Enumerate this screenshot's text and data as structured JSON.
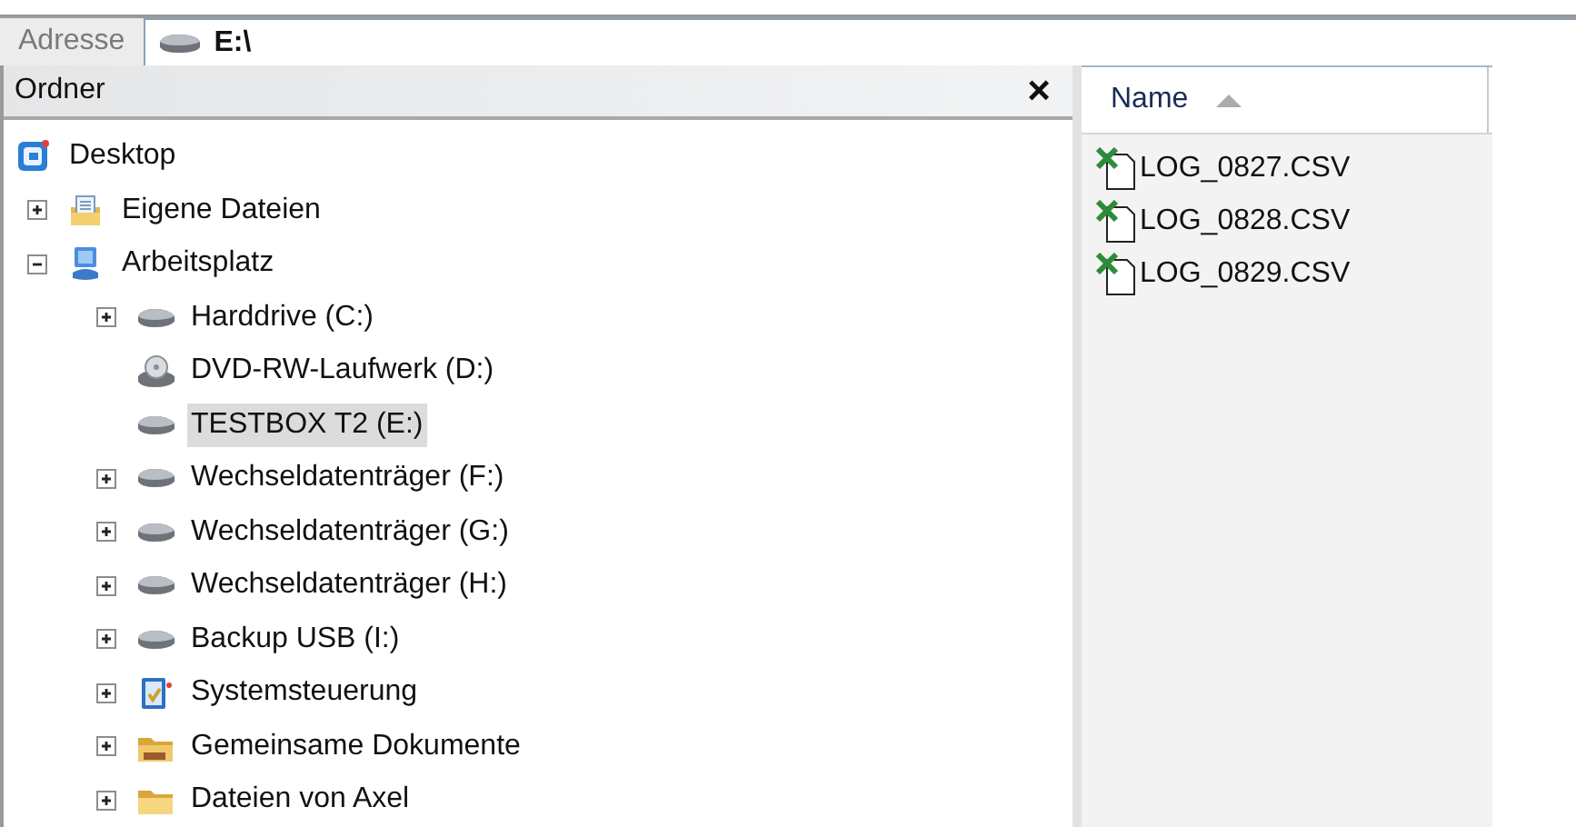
{
  "address_bar": {
    "label": "Adresse",
    "value": "E:\\"
  },
  "folder_pane": {
    "title": "Ordner",
    "close": "×",
    "tree": [
      {
        "label": "Desktop",
        "kind": "desktop",
        "selected": false,
        "children": [
          {
            "label": "Eigene Dateien",
            "kind": "documents",
            "expanded": false,
            "selected": false
          },
          {
            "label": "Arbeitsplatz",
            "kind": "computer",
            "expanded": true,
            "selected": false,
            "children": [
              {
                "label": "Harddrive (C:)",
                "kind": "drive",
                "expanded": false,
                "selected": false
              },
              {
                "label": "DVD-RW-Laufwerk (D:)",
                "kind": "dvd",
                "selected": false
              },
              {
                "label": "TESTBOX T2 (E:)",
                "kind": "drive",
                "selected": true
              },
              {
                "label": "Wechseldatenträger (F:)",
                "kind": "drive",
                "expanded": false,
                "selected": false
              },
              {
                "label": "Wechseldatenträger (G:)",
                "kind": "drive",
                "expanded": false,
                "selected": false
              },
              {
                "label": "Wechseldatenträger (H:)",
                "kind": "drive",
                "expanded": false,
                "selected": false
              },
              {
                "label": "Backup USB (I:)",
                "kind": "drive",
                "expanded": false,
                "selected": false
              },
              {
                "label": "Systemsteuerung",
                "kind": "control",
                "expanded": false,
                "selected": false
              },
              {
                "label": "Gemeinsame Dokumente",
                "kind": "shared",
                "expanded": false,
                "selected": false
              },
              {
                "label": "Dateien von Axel",
                "kind": "folder",
                "expanded": false,
                "selected": false
              }
            ]
          }
        ]
      }
    ]
  },
  "file_list": {
    "columns": [
      {
        "label": "Name",
        "sorted": true
      }
    ],
    "files": [
      {
        "name": "LOG_0827.CSV"
      },
      {
        "name": "LOG_0828.CSV"
      },
      {
        "name": "LOG_0829.CSV"
      }
    ]
  }
}
